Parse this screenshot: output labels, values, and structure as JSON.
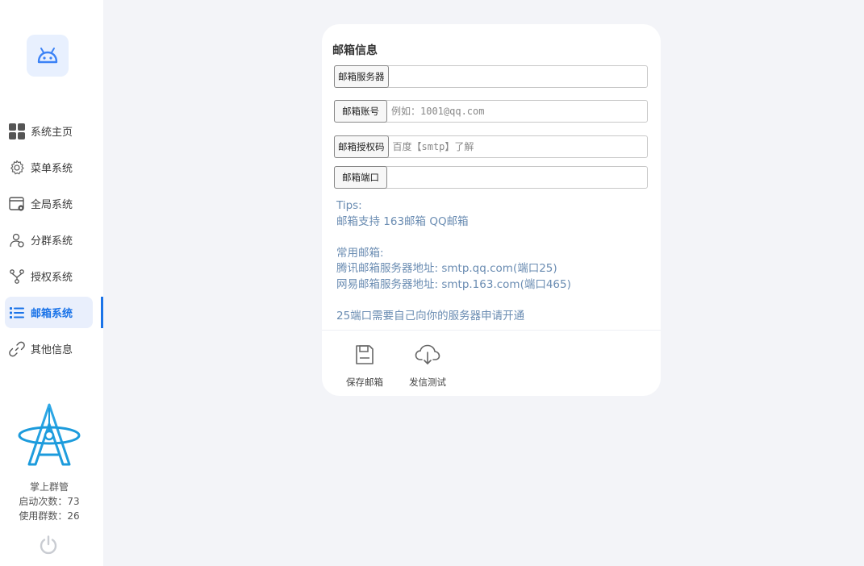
{
  "sidebar": {
    "items": [
      {
        "label": "系统主页",
        "icon": "grid-icon",
        "active": false
      },
      {
        "label": "菜单系统",
        "icon": "gear-icon",
        "active": false
      },
      {
        "label": "全局系统",
        "icon": "window-settings-icon",
        "active": false
      },
      {
        "label": "分群系统",
        "icon": "user-group-icon",
        "active": false
      },
      {
        "label": "授权系统",
        "icon": "fork-icon",
        "active": false
      },
      {
        "label": "邮箱系统",
        "icon": "list-icon",
        "active": true
      },
      {
        "label": "其他信息",
        "icon": "link-icon",
        "active": false
      }
    ],
    "app_name": "掌上群管",
    "launch_count": "启动次数：73",
    "group_count": "使用群数：26",
    "accent_color": "#1a73e8"
  },
  "card": {
    "title": "邮箱信息",
    "fields": [
      {
        "label": "邮箱服务器",
        "value": "",
        "placeholder": ""
      },
      {
        "label": "邮箱账号",
        "value": "",
        "placeholder": "例如：1001@qq.com"
      },
      {
        "label": "邮箱授权码",
        "value": "",
        "placeholder": "百度【smtp】了解"
      },
      {
        "label": "邮箱端口",
        "value": "",
        "placeholder": ""
      }
    ],
    "tips": [
      "Tips:",
      "邮箱支持 163邮箱 QQ邮箱",
      "",
      "常用邮箱:",
      "腾讯邮箱服务器地址: smtp.qq.com(端口25)",
      "网易邮箱服务器地址: smtp.163.com(端口465)",
      "",
      "25端口需要自己向你的服务器申请开通"
    ],
    "actions": {
      "save_label": "保存邮箱",
      "test_label": "发信测试"
    }
  }
}
